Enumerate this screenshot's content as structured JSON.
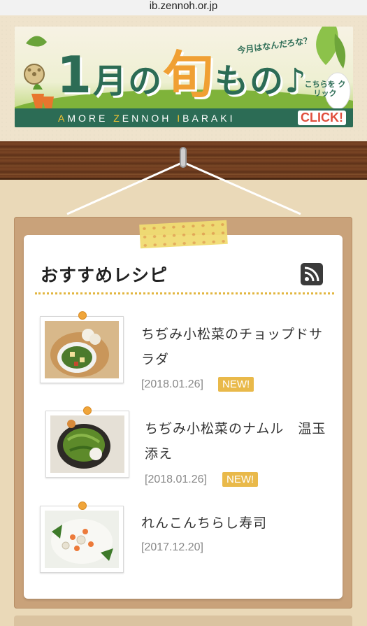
{
  "browser": {
    "url": "ib.zennoh.or.jp"
  },
  "banner": {
    "title_num": "1",
    "title_part1": "月の",
    "title_kanji": "旬",
    "title_part2": "もの",
    "title_note": "♪",
    "tagline": "今月はなんだろな？",
    "subtitle_a": "A",
    "subtitle_b": "MORE ",
    "subtitle_c": "Z",
    "subtitle_d": "ENNOH ",
    "subtitle_e": "I",
    "subtitle_f": "BARAKI",
    "click_label": "こちらを クリック",
    "click_text": "CLICK!"
  },
  "section": {
    "title": "おすすめレシピ"
  },
  "recipes": [
    {
      "title": "ちぢみ小松菜のチョップドサラダ",
      "date": "[2018.01.26]",
      "badge": "NEW!"
    },
    {
      "title": "ちぢみ小松菜のナムル　温玉添え",
      "date": "[2018.01.26]",
      "badge": "NEW!"
    },
    {
      "title": "れんこんちらし寿司",
      "date": "[2017.12.20]"
    }
  ],
  "colors": {
    "background": "#efe3cc",
    "banner_green": "#2c6c55",
    "accent_orange": "#f0a033",
    "badge": "#e9b94a",
    "board": "#c9a27a"
  }
}
